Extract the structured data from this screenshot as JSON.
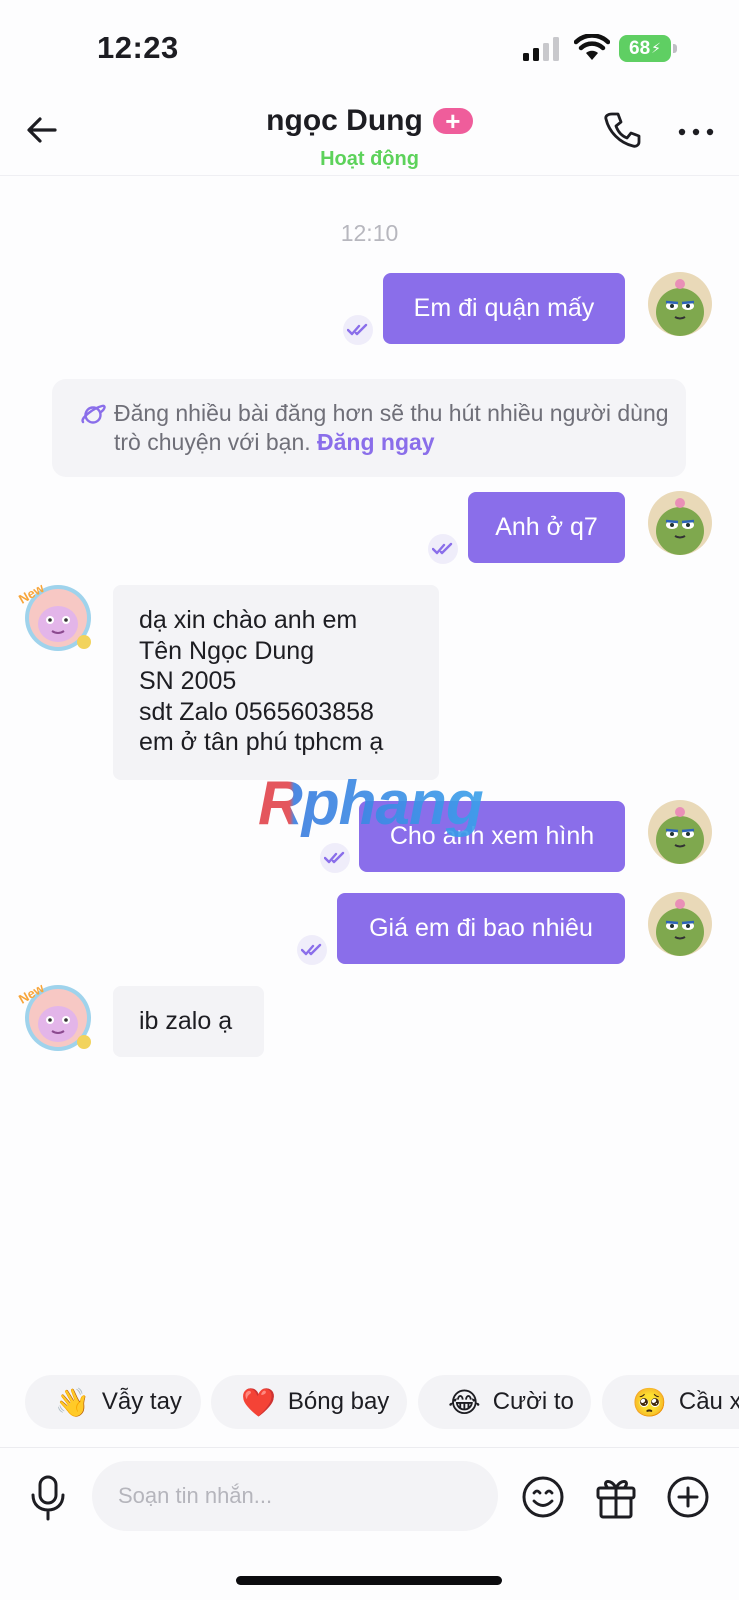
{
  "status_bar": {
    "time": "12:23",
    "battery": "68"
  },
  "header": {
    "contact_name": "ngọc Dung",
    "badge": "+",
    "status": "Hoạt động"
  },
  "chat": {
    "timestamp": "12:10",
    "messages": [
      {
        "from": "me",
        "text": "Em đi quận mấy"
      },
      {
        "from": "me",
        "text": "Anh ở q7"
      },
      {
        "from": "her",
        "lines": [
          "dạ xin chào anh em",
          "Tên Ngọc Dung",
          "SN 2005",
          "sdt Zalo 0565603858",
          "em ở tân phú tphcm ạ"
        ]
      },
      {
        "from": "me",
        "text": "Cho anh xem hình"
      },
      {
        "from": "me",
        "text": "Giá em đi bao nhiêu"
      },
      {
        "from": "her",
        "text": "ib zalo ạ"
      }
    ],
    "notice": {
      "text": "Đăng nhiều bài đăng hơn sẽ thu hút nhiều người dùng trò chuyện với bạn.",
      "link": "Đăng ngay"
    },
    "avatar_badge": "New",
    "watermark": "Rphang"
  },
  "quick_replies": [
    {
      "emoji": "👋",
      "label": "Vẫy tay"
    },
    {
      "emoji": "❤️",
      "label": "Bóng bay"
    },
    {
      "emoji": "😂",
      "label": "Cười to"
    },
    {
      "emoji": "🥺",
      "label": "Cầu xi"
    }
  ],
  "composer": {
    "placeholder": "Soạn tin nhắn..."
  },
  "colors": {
    "accent": "#8a6eea",
    "online": "#5dd25b",
    "badge": "#ef5d9b",
    "battery": "#5fcf63"
  }
}
